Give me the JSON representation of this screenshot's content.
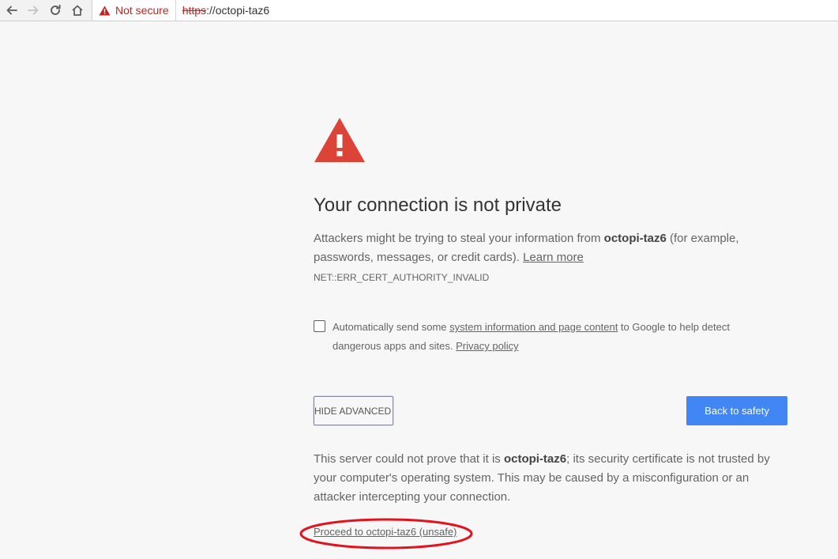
{
  "browser": {
    "security_chip_label": "Not secure",
    "url_scheme": "https",
    "url_separator": "://",
    "url_host": "octopi-taz6"
  },
  "interstitial": {
    "heading": "Your connection is not private",
    "msg_prefix": "Attackers might be trying to steal your information from ",
    "msg_host": "octopi-taz6",
    "msg_suffix": " (for example, passwords, messages, or credit cards). ",
    "learn_more": "Learn more",
    "error_code": "NET::ERR_CERT_AUTHORITY_INVALID",
    "optin_prefix": "Automatically send some ",
    "optin_link": "system information and page content",
    "optin_middle": " to Google to help detect dangerous apps and sites. ",
    "privacy_policy": "Privacy policy",
    "optin_checked": false,
    "hide_advanced_label": "HIDE ADVANCED",
    "back_to_safety_label": "Back to safety",
    "details_prefix": "This server could not prove that it is ",
    "details_host": "octopi-taz6",
    "details_suffix": "; its security certificate is not trusted by your computer's operating system. This may be caused by a misconfiguration or an attacker intercepting your connection.",
    "proceed_link": "Proceed to octopi-taz6 (unsafe)"
  },
  "colors": {
    "warning_red": "#db4437",
    "not_secure_red": "#c5221f",
    "primary_blue": "#4285f4",
    "annotation_red": "#e0141e",
    "page_background": "#f7f7f7"
  },
  "icons": {
    "back": "arrow-left-icon",
    "forward": "arrow-right-icon",
    "reload": "reload-icon",
    "home": "home-icon",
    "security": "warning-triangle-icon",
    "hero": "warning-triangle-icon"
  }
}
